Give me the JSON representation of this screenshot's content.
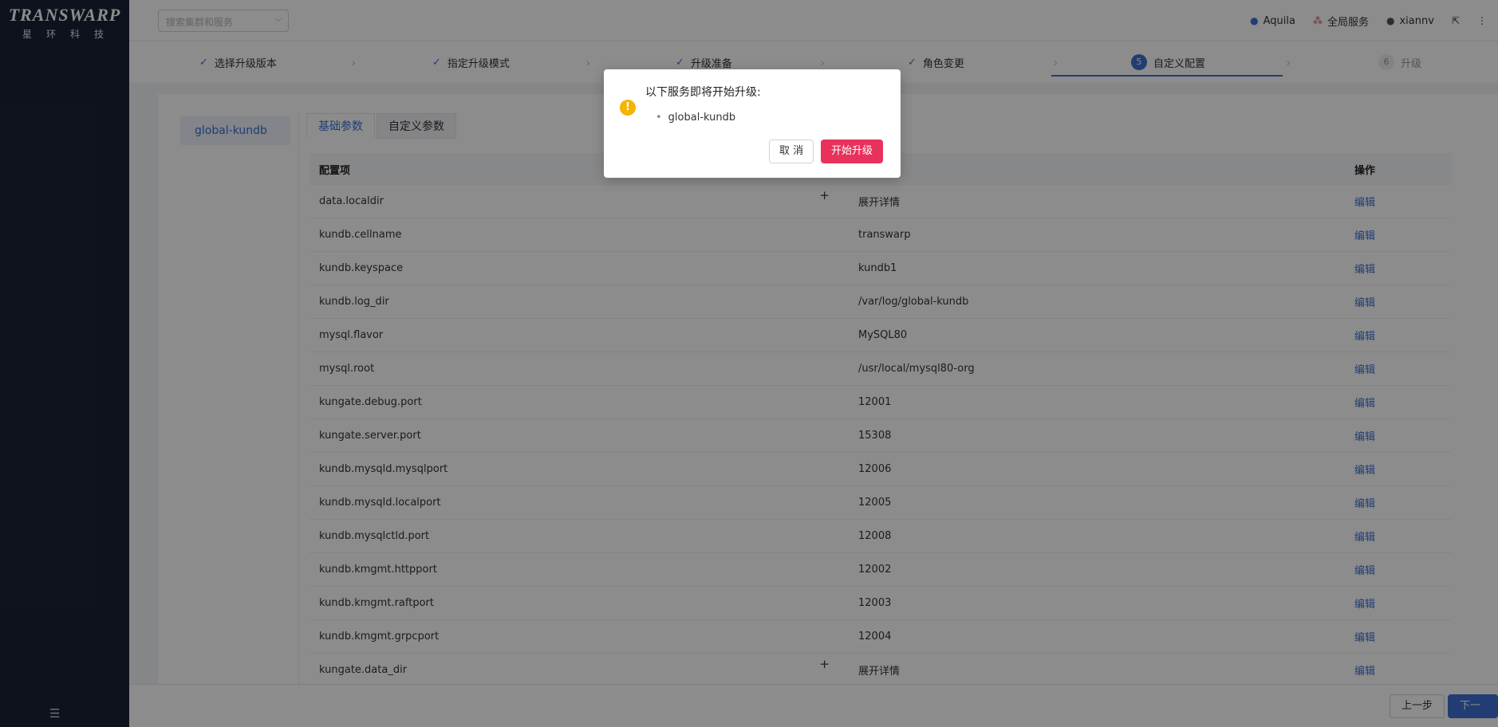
{
  "sidebar": {
    "logo": {
      "main": "TRANSWARP",
      "sub": "星环科技"
    },
    "collapse_icon": "collapse-menu-icon"
  },
  "header": {
    "search": {
      "placeholder": "搜索集群和服务"
    },
    "cluster": "Aquila",
    "global_services": "全局服务",
    "user": "xiannv"
  },
  "steps": [
    {
      "label": "选择升级版本",
      "state": "done"
    },
    {
      "label": "指定升级模式",
      "state": "done"
    },
    {
      "label": "升级准备",
      "state": "done"
    },
    {
      "label": "角色变更",
      "state": "done"
    },
    {
      "label": "自定义配置",
      "state": "active",
      "number": "5"
    },
    {
      "label": "升级",
      "state": "todo",
      "number": "6"
    }
  ],
  "main": {
    "service": "global-kundb",
    "tabs": [
      {
        "label": "基础参数",
        "active": true
      },
      {
        "label": "自定义参数",
        "active": false
      }
    ],
    "table": {
      "headers": {
        "key": "配置项",
        "op": "操作"
      },
      "edit_label": "编辑",
      "rows": [
        {
          "key": "data.localdir",
          "value": "展开详情",
          "expandable": true
        },
        {
          "key": "kundb.cellname",
          "value": "transwarp"
        },
        {
          "key": "kundb.keyspace",
          "value": "kundb1"
        },
        {
          "key": "kundb.log_dir",
          "value": "/var/log/global-kundb"
        },
        {
          "key": "mysql.flavor",
          "value": "MySQL80"
        },
        {
          "key": "mysql.root",
          "value": "/usr/local/mysql80-org"
        },
        {
          "key": "kungate.debug.port",
          "value": "12001"
        },
        {
          "key": "kungate.server.port",
          "value": "15308"
        },
        {
          "key": "kundb.mysqld.mysqlport",
          "value": "12006"
        },
        {
          "key": "kundb.mysqld.localport",
          "value": "12005"
        },
        {
          "key": "kundb.mysqlctld.port",
          "value": "12008"
        },
        {
          "key": "kundb.kmgmt.httpport",
          "value": "12002"
        },
        {
          "key": "kundb.kmgmt.raftport",
          "value": "12003"
        },
        {
          "key": "kundb.kmgmt.grpcport",
          "value": "12004"
        },
        {
          "key": "kungate.data_dir",
          "value": "展开详情",
          "expandable": true
        }
      ]
    }
  },
  "footer": {
    "prev": "上一步",
    "next": "下一步"
  },
  "modal": {
    "title": "以下服务即将开始升级:",
    "services": [
      "global-kundb"
    ],
    "cancel": "取 消",
    "confirm": "开始升级",
    "icon": "warning-icon"
  },
  "colors": {
    "primary": "#3c6fd1",
    "danger": "#e8325c",
    "warning": "#f5b400",
    "sidebar": "#1b2233"
  }
}
